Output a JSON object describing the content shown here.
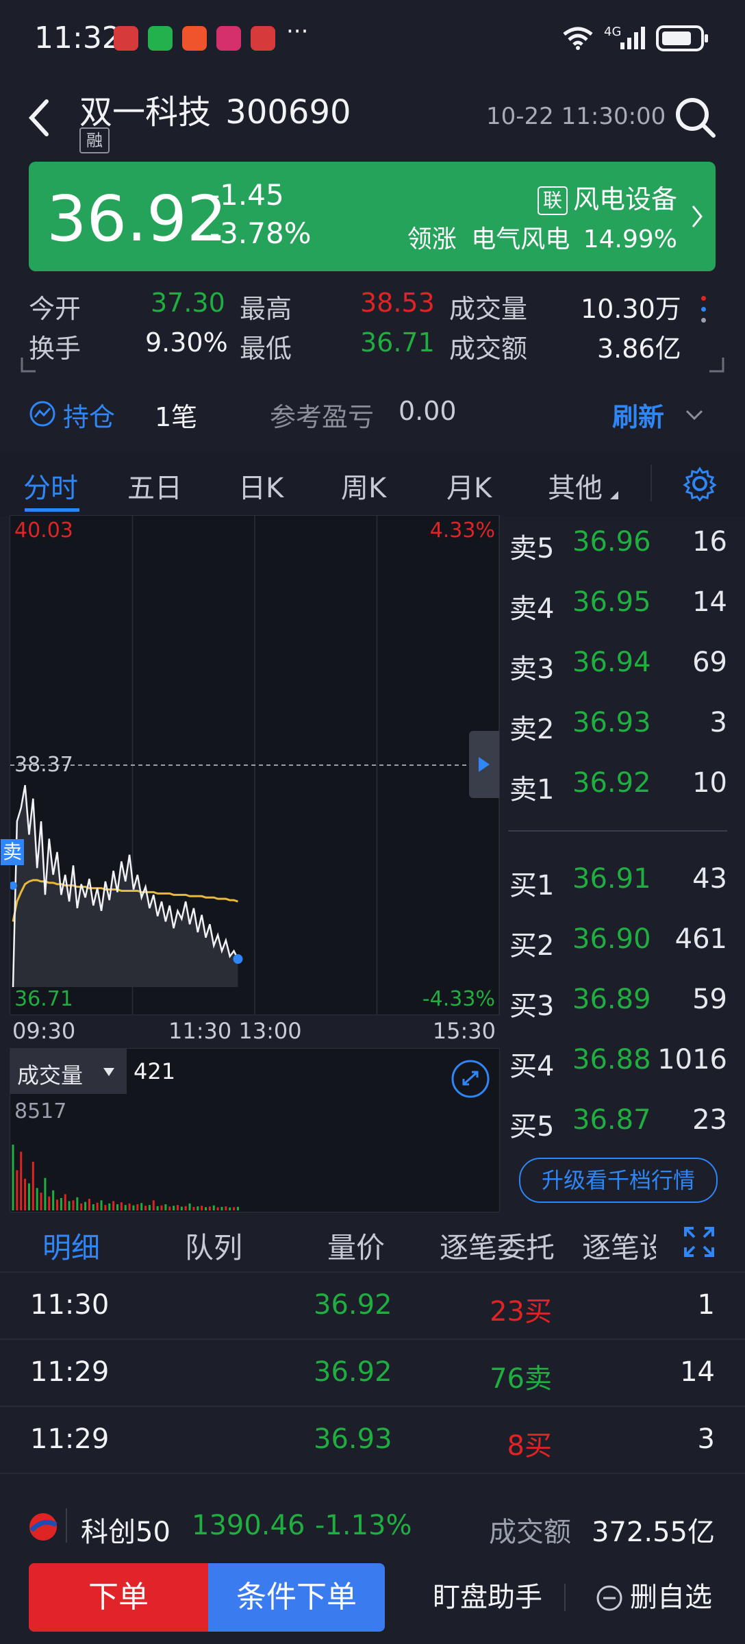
{
  "status_bar": {
    "time": "11:32",
    "more": "···",
    "network": "4G"
  },
  "header": {
    "back_icon": "back-icon",
    "name": "双一科技",
    "code": "300690",
    "tag": "融",
    "datetime": "10-22 11:30:00"
  },
  "quote": {
    "price": "36.92",
    "change": "-1.45",
    "change_pct": "-3.78%",
    "sector_tag": "联",
    "sector": "风电设备",
    "lead_label": "领涨",
    "lead_name": "电气风电",
    "lead_pct": "14.99%"
  },
  "stats": [
    {
      "label": "今开",
      "value": "37.30",
      "color": "green"
    },
    {
      "label": "最高",
      "value": "38.53",
      "color": "red"
    },
    {
      "label": "成交量",
      "value": "10.30万",
      "color": "white"
    },
    {
      "label": "换手",
      "value": "9.30%",
      "color": "white"
    },
    {
      "label": "最低",
      "value": "36.71",
      "color": "green"
    },
    {
      "label": "成交额",
      "value": "3.86亿",
      "color": "white"
    }
  ],
  "position": {
    "label": "持仓",
    "count": "1笔",
    "pl_label": "参考盈亏",
    "pl_value": "0.00",
    "refresh": "刷新"
  },
  "tabs": [
    "分时",
    "五日",
    "日K",
    "周K",
    "月K",
    "其他"
  ],
  "chart_data": {
    "type": "line",
    "y_max": "40.03",
    "y_ref": "38.37",
    "y_min": "36.71",
    "pct_max": "4.33%",
    "pct_min": "-4.33%",
    "x_ticks": [
      "09:30",
      "11:30 13:00",
      "15:30"
    ],
    "sell_marker": "卖",
    "ylim": [
      36.71,
      40.03
    ],
    "price": [
      36.71,
      37.95,
      38.05,
      38.22,
      37.85,
      38.12,
      37.6,
      37.95,
      37.4,
      37.82,
      37.55,
      37.72,
      37.4,
      37.55,
      37.35,
      37.62,
      37.3,
      37.48,
      37.38,
      37.52,
      37.32,
      37.45,
      37.28,
      37.5,
      37.36,
      37.58,
      37.42,
      37.65,
      37.5,
      37.7,
      37.44,
      37.55,
      37.38,
      37.46,
      37.3,
      37.4,
      37.24,
      37.35,
      37.2,
      37.32,
      37.15,
      37.28,
      37.22,
      37.35,
      37.18,
      37.3,
      37.12,
      37.25,
      37.08,
      37.18,
      37.02,
      37.1,
      36.98,
      37.06,
      36.94,
      36.98,
      36.92
    ],
    "avg": [
      37.2,
      37.35,
      37.42,
      37.48,
      37.5,
      37.51,
      37.51,
      37.5,
      37.5,
      37.49,
      37.49,
      37.48,
      37.48,
      37.47,
      37.47,
      37.47,
      37.46,
      37.46,
      37.46,
      37.45,
      37.45,
      37.45,
      37.45,
      37.44,
      37.44,
      37.44,
      37.44,
      37.43,
      37.43,
      37.43,
      37.43,
      37.43,
      37.42,
      37.42,
      37.42,
      37.42,
      37.41,
      37.41,
      37.41,
      37.41,
      37.4,
      37.4,
      37.4,
      37.4,
      37.39,
      37.39,
      37.39,
      37.39,
      37.38,
      37.38,
      37.38,
      37.37,
      37.37,
      37.37,
      37.36,
      37.36,
      37.35
    ],
    "volume_label": "成交量",
    "volume_current": "421",
    "volume_max": "8517",
    "volume": [
      8517,
      5200,
      7600,
      4100,
      3500,
      6300,
      2900,
      2300,
      4200,
      1800,
      2600,
      1400,
      1600,
      2100,
      1200,
      1300,
      1700,
      900,
      1100,
      1500,
      800,
      1000,
      1300,
      700,
      900,
      1200,
      800,
      1050,
      700,
      900,
      650,
      800,
      950,
      600,
      700,
      1300,
      550,
      650,
      800,
      500,
      600,
      700,
      480,
      560,
      900,
      450,
      520,
      600,
      420,
      500,
      650,
      400,
      450,
      520,
      380,
      421,
      460
    ]
  },
  "order_book": {
    "asks": [
      {
        "label": "卖5",
        "price": "36.96",
        "vol": "16"
      },
      {
        "label": "卖4",
        "price": "36.95",
        "vol": "14"
      },
      {
        "label": "卖3",
        "price": "36.94",
        "vol": "69"
      },
      {
        "label": "卖2",
        "price": "36.93",
        "vol": "3"
      },
      {
        "label": "卖1",
        "price": "36.92",
        "vol": "10"
      }
    ],
    "bids": [
      {
        "label": "买1",
        "price": "36.91",
        "vol": "43"
      },
      {
        "label": "买2",
        "price": "36.90",
        "vol": "461"
      },
      {
        "label": "买3",
        "price": "36.89",
        "vol": "59"
      },
      {
        "label": "买4",
        "price": "36.88",
        "vol": "1016"
      },
      {
        "label": "买5",
        "price": "36.87",
        "vol": "23"
      }
    ],
    "upgrade": "升级看千档行情"
  },
  "detail_tabs": [
    "明细",
    "队列",
    "量价",
    "逐笔委托",
    "逐笔设"
  ],
  "trades": [
    {
      "time": "11:30",
      "price": "36.92",
      "vol": "23买",
      "side": "buy",
      "count": "1"
    },
    {
      "time": "11:29",
      "price": "36.92",
      "vol": "76卖",
      "side": "sell",
      "count": "14"
    },
    {
      "time": "11:29",
      "price": "36.93",
      "vol": "8买",
      "side": "buy",
      "count": "3"
    }
  ],
  "index_bar": {
    "name": "科创50",
    "value": "1390.46",
    "pct": "-1.13%",
    "turnover_label": "成交额",
    "turnover": "372.55亿"
  },
  "bottom": {
    "order": "下单",
    "cond_order": "条件下单",
    "assistant": "盯盘助手",
    "remove": "删自选"
  }
}
